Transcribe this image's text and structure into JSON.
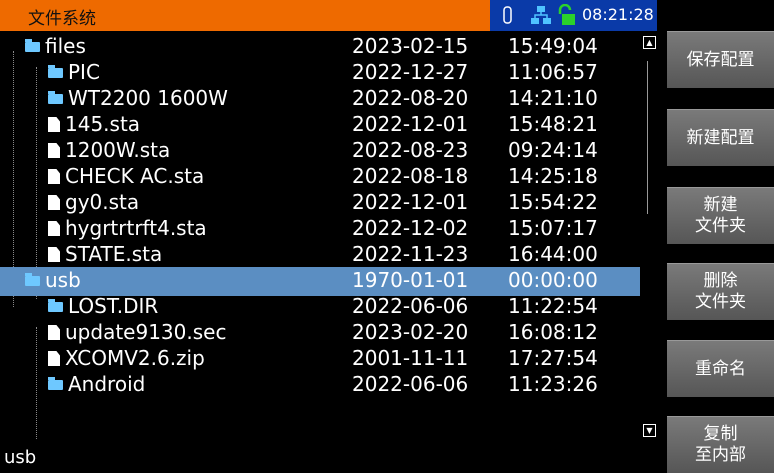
{
  "title": "文件系统",
  "status": {
    "time": "08:21:28",
    "icons": [
      "usb-icon",
      "network-icon",
      "lock-icon"
    ]
  },
  "rows": [
    {
      "name": "files",
      "type": "folder",
      "date": "2023-02-15",
      "time": "15:49:04"
    },
    {
      "name": "PIC",
      "type": "folder",
      "date": "2022-12-27",
      "time": "11:06:57"
    },
    {
      "name": "WT2200 1600W",
      "type": "folder",
      "date": "2022-08-20",
      "time": "14:21:10"
    },
    {
      "name": "145.sta",
      "type": "file",
      "date": "2022-12-01",
      "time": "15:48:21"
    },
    {
      "name": "1200W.sta",
      "type": "file",
      "date": "2022-08-23",
      "time": "09:24:14"
    },
    {
      "name": "CHECK  AC.sta",
      "type": "file",
      "date": "2022-08-18",
      "time": "14:25:18"
    },
    {
      "name": "gy0.sta",
      "type": "file",
      "date": "2022-12-01",
      "time": "15:54:22"
    },
    {
      "name": "hygrtrtrft4.sta",
      "type": "file",
      "date": "2022-12-02",
      "time": "15:07:17"
    },
    {
      "name": "STATE.sta",
      "type": "file",
      "date": "2022-11-23",
      "time": "16:44:00"
    },
    {
      "name": "usb",
      "type": "folder",
      "date": "1970-01-01",
      "time": "00:00:00",
      "selected": true
    },
    {
      "name": "LOST.DIR",
      "type": "folder",
      "date": "2022-06-06",
      "time": "11:22:54"
    },
    {
      "name": "update9130.sec",
      "type": "file",
      "date": "2023-02-20",
      "time": "16:08:12"
    },
    {
      "name": "XCOMV2.6.zip",
      "type": "file",
      "date": "2001-11-11",
      "time": "17:27:54"
    },
    {
      "name": "Android",
      "type": "folder",
      "date": "2022-06-06",
      "time": "11:23:26"
    }
  ],
  "footer": {
    "path": "usb"
  },
  "buttons": [
    {
      "label": "保存配置"
    },
    {
      "label": "新建配置"
    },
    {
      "label": "新建\n文件夹"
    },
    {
      "label": "删除\n文件夹"
    },
    {
      "label": "重命名"
    },
    {
      "label": "复制\n至内部"
    }
  ]
}
